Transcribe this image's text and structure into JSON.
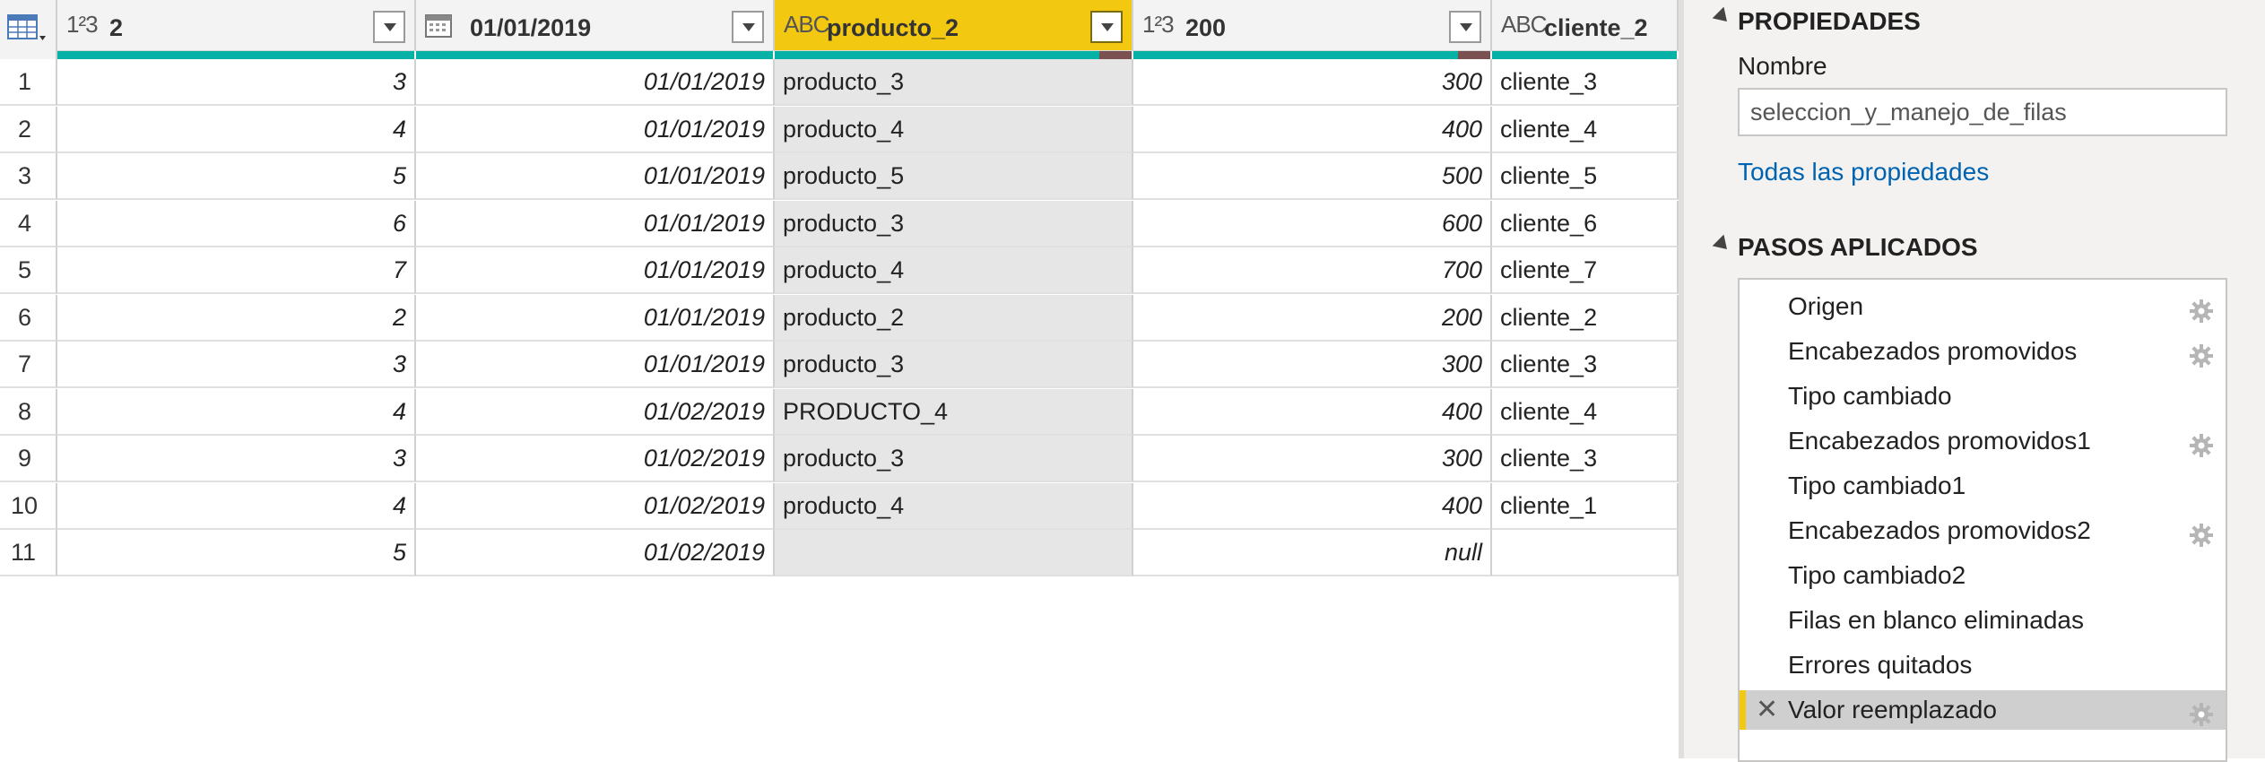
{
  "grid": {
    "columns": [
      {
        "type_glyph": "1²3",
        "name": "2",
        "kind": "num"
      },
      {
        "type_glyph": "calendar-icon",
        "name": "01/01/2019",
        "kind": "date"
      },
      {
        "type_glyph": "ABC",
        "name": "producto_2",
        "kind": "txt",
        "selected": true
      },
      {
        "type_glyph": "1²3",
        "name": "200",
        "kind": "num"
      },
      {
        "type_glyph": "ABC",
        "name": "cliente_2",
        "kind": "txt"
      }
    ],
    "rows": [
      [
        "1",
        "3",
        "01/01/2019",
        "producto_3",
        "300",
        "cliente_3"
      ],
      [
        "2",
        "4",
        "01/01/2019",
        "producto_4",
        "400",
        "cliente_4"
      ],
      [
        "3",
        "5",
        "01/01/2019",
        "producto_5",
        "500",
        "cliente_5"
      ],
      [
        "4",
        "6",
        "01/01/2019",
        "producto_3",
        "600",
        "cliente_6"
      ],
      [
        "5",
        "7",
        "01/01/2019",
        "producto_4",
        "700",
        "cliente_7"
      ],
      [
        "6",
        "2",
        "01/01/2019",
        "producto_2",
        "200",
        "cliente_2"
      ],
      [
        "7",
        "3",
        "01/01/2019",
        "producto_3",
        "300",
        "cliente_3"
      ],
      [
        "8",
        "4",
        "01/02/2019",
        "PRODUCTO_4",
        "400",
        "cliente_4"
      ],
      [
        "9",
        "3",
        "01/02/2019",
        "producto_3",
        "300",
        "cliente_3"
      ],
      [
        "10",
        "4",
        "01/02/2019",
        "producto_4",
        "400",
        "cliente_1"
      ],
      [
        "11",
        "5",
        "01/02/2019",
        "",
        "null",
        ""
      ]
    ]
  },
  "pane": {
    "properties_title": "PROPIEDADES",
    "name_label": "Nombre",
    "name_value": "seleccion_y_manejo_de_filas",
    "all_props_link": "Todas las propiedades",
    "steps_title": "PASOS APLICADOS",
    "steps": [
      {
        "label": "Origen",
        "gear": true
      },
      {
        "label": "Encabezados promovidos",
        "gear": true
      },
      {
        "label": "Tipo cambiado",
        "gear": false
      },
      {
        "label": "Encabezados promovidos1",
        "gear": true
      },
      {
        "label": "Tipo cambiado1",
        "gear": false
      },
      {
        "label": "Encabezados promovidos2",
        "gear": true
      },
      {
        "label": "Tipo cambiado2",
        "gear": false
      },
      {
        "label": "Filas en blanco eliminadas",
        "gear": false
      },
      {
        "label": "Errores quitados",
        "gear": false
      },
      {
        "label": "Valor reemplazado",
        "gear": true,
        "active": true
      }
    ]
  },
  "colors": {
    "accent": "#f2c811",
    "quality": "#06b2a5",
    "link": "#0063b1"
  }
}
